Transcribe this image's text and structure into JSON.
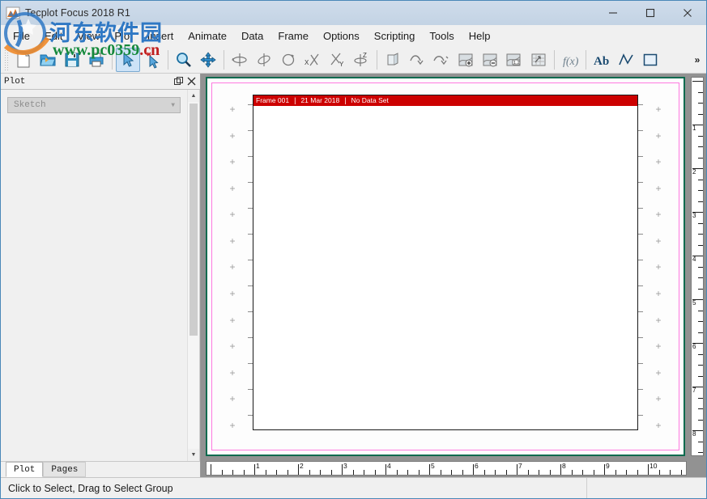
{
  "window": {
    "title": "Tecplot Focus 2018 R1",
    "icon": "tecplot-logo-icon",
    "controls": [
      {
        "name": "minimize-button",
        "glyph": "—"
      },
      {
        "name": "maximize-button",
        "glyph": "□"
      },
      {
        "name": "close-button",
        "glyph": "✕"
      }
    ]
  },
  "menubar": {
    "items": [
      {
        "label": "File"
      },
      {
        "label": "Edit"
      },
      {
        "label": "View"
      },
      {
        "label": "Plot"
      },
      {
        "label": "Insert"
      },
      {
        "label": "Animate"
      },
      {
        "label": "Data"
      },
      {
        "label": "Frame"
      },
      {
        "label": "Options"
      },
      {
        "label": "Scripting"
      },
      {
        "label": "Tools"
      },
      {
        "label": "Help"
      }
    ]
  },
  "toolbar": {
    "overflow_label": "»",
    "groups": [
      {
        "buttons": [
          {
            "name": "new-layout-icon",
            "title": "New Layout"
          },
          {
            "name": "open-layout-icon",
            "title": "Open Layout"
          },
          {
            "name": "save-layout-icon",
            "title": "Save Layout"
          },
          {
            "name": "print-icon",
            "title": "Print"
          }
        ]
      },
      {
        "buttons": [
          {
            "name": "select-tool-icon",
            "title": "Select",
            "active": true
          },
          {
            "name": "adjust-tool-icon",
            "title": "Adjust"
          }
        ]
      },
      {
        "buttons": [
          {
            "name": "zoom-tool-icon",
            "title": "Zoom"
          },
          {
            "name": "translate-tool-icon",
            "title": "Translate / Magnify"
          }
        ]
      },
      {
        "buttons": [
          {
            "name": "rotate-spherical-icon",
            "title": "Rotate Spherical"
          },
          {
            "name": "rotate-roller-icon",
            "title": "Rotate Roller Ball"
          },
          {
            "name": "rotate-twist-icon",
            "title": "Rotate Twist"
          },
          {
            "name": "rotate-x-icon",
            "title": "Rotate X"
          },
          {
            "name": "rotate-y-icon",
            "title": "Rotate Y"
          },
          {
            "name": "rotate-z-icon",
            "title": "Rotate Z"
          }
        ]
      },
      {
        "buttons": [
          {
            "name": "3d-view-icon",
            "title": "3D View Details"
          },
          {
            "name": "redraw-icon",
            "title": "Redraw"
          },
          {
            "name": "redraw-all-icon",
            "title": "Redraw All"
          },
          {
            "name": "add-contour-level-icon",
            "title": "Add Contour Level"
          },
          {
            "name": "remove-contour-level-icon",
            "title": "Remove Contour Level"
          },
          {
            "name": "contour-label-icon",
            "title": "Contour Label"
          },
          {
            "name": "extract-points-icon",
            "title": "Extract Points"
          }
        ]
      },
      {
        "buttons": [
          {
            "name": "function-icon",
            "title": "Specify Equations"
          }
        ]
      },
      {
        "buttons": [
          {
            "name": "text-tool-icon",
            "title": "Text"
          },
          {
            "name": "polyline-tool-icon",
            "title": "Polyline"
          },
          {
            "name": "rectangle-tool-icon",
            "title": "Rectangle"
          }
        ]
      }
    ]
  },
  "sidebar": {
    "panel_title": "Plot",
    "header_buttons": [
      {
        "name": "float-panel-button",
        "glyph": "❐"
      },
      {
        "name": "close-panel-button",
        "glyph": "✕"
      }
    ],
    "plot_type_combo": {
      "value": "Sketch",
      "arrow": "▼"
    },
    "scrollbar": {
      "up_arrow": "▲",
      "down_arrow": "▼"
    },
    "tabs": [
      {
        "label": "Plot",
        "active": true
      },
      {
        "label": "Pages",
        "active": false
      }
    ]
  },
  "workspace": {
    "frame": {
      "name": "Frame 001",
      "date": "21 Mar 2018",
      "dataset": "No Data Set",
      "separator": "|"
    },
    "colors": {
      "frame_header_bg": "#cc0000",
      "frame_header_text": "#ffffff",
      "page_border": "#ff7ae0",
      "workspace_border": "#0b6b4f",
      "canvas_bg": "#929292"
    },
    "cross_marker": "+",
    "h_ruler": {
      "labels": [
        "1",
        "2",
        "3",
        "4",
        "5",
        "6",
        "7",
        "8",
        "9",
        "10"
      ]
    },
    "v_ruler": {
      "labels": [
        "1",
        "2",
        "3",
        "4",
        "5",
        "6",
        "7",
        "8"
      ]
    }
  },
  "statusbar": {
    "message": "Click to Select, Drag to Select Group"
  },
  "watermark": {
    "chinese": "河东软件园",
    "url_main": "www.pc0359",
    "url_tld": ".cn"
  }
}
